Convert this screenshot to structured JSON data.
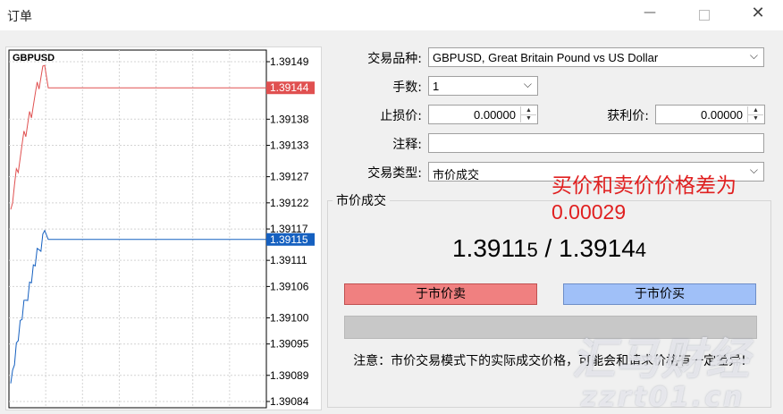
{
  "window": {
    "title": "订单",
    "minimize_glyph": "—",
    "close_glyph": "✕"
  },
  "chart": {
    "symbol": "GBPUSD",
    "price_scale": [
      "1.39149",
      "1.39144",
      "1.39138",
      "1.39133",
      "1.39127",
      "1.39122",
      "1.39117",
      "1.39115",
      "1.39111",
      "1.39106",
      "1.39100",
      "1.39095",
      "1.39089",
      "1.39084"
    ],
    "ask_label": "1.39144",
    "bid_label": "1.39115",
    "colors": {
      "ask": "#e05050",
      "bid": "#1560c0",
      "grid": "#d4d4d4"
    }
  },
  "form": {
    "symbol_label": "交易品种:",
    "symbol_value": "GBPUSD, Great Britain Pound vs US Dollar",
    "volume_label": "手数:",
    "volume_value": "1",
    "sl_label": "止损价:",
    "sl_value": "0.00000",
    "tp_label": "获利价:",
    "tp_value": "0.00000",
    "comment_label": "注释:",
    "comment_value": "",
    "type_label": "交易类型:",
    "type_value": "市价成交"
  },
  "market": {
    "group_title": "市价成交",
    "bid_main": "1.3911",
    "bid_small": "5",
    "separator": " / ",
    "ask_main": "1.3914",
    "ask_small": "4",
    "sell_button": "于市价卖",
    "buy_button": "于市价买",
    "note": "注意：市价交易模式下的实际成交价格，可能会和请求价格有一定差异!"
  },
  "annotation": {
    "line1": "买价和卖价价格差为",
    "line2": "0.00029"
  },
  "watermark": {
    "line1": "汇马财经",
    "line2": "zzrt01.cn"
  },
  "colors": {
    "sell_button": "#f08080",
    "buy_button": "#a0c0f8",
    "annotation": "#e02020"
  }
}
